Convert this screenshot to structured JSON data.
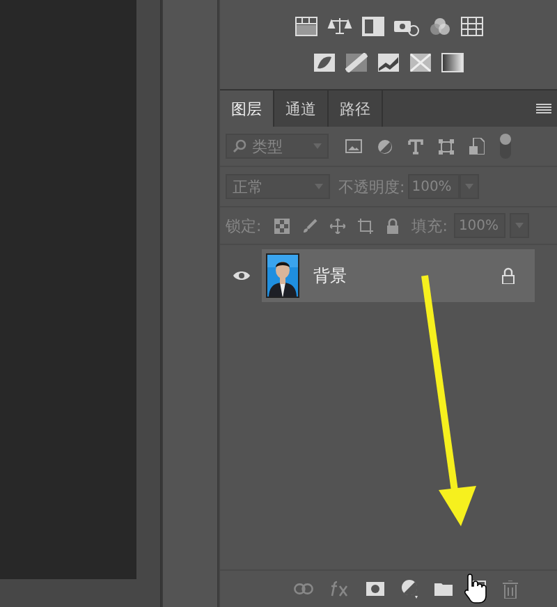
{
  "tabs": [
    {
      "label": "图层",
      "selected": true
    },
    {
      "label": "通道",
      "selected": false
    },
    {
      "label": "路径",
      "selected": false
    }
  ],
  "filter": {
    "value": "类型",
    "disabled": true
  },
  "blend_mode": {
    "value": "正常",
    "disabled": true
  },
  "opacity": {
    "label": "不透明度:",
    "value": "100%",
    "disabled": true
  },
  "lock": {
    "label": "锁定:"
  },
  "fill": {
    "label": "填充:",
    "value": "100%",
    "disabled": true
  },
  "layers": [
    {
      "name": "背景",
      "visible": true,
      "locked": true,
      "selected": true
    }
  ]
}
